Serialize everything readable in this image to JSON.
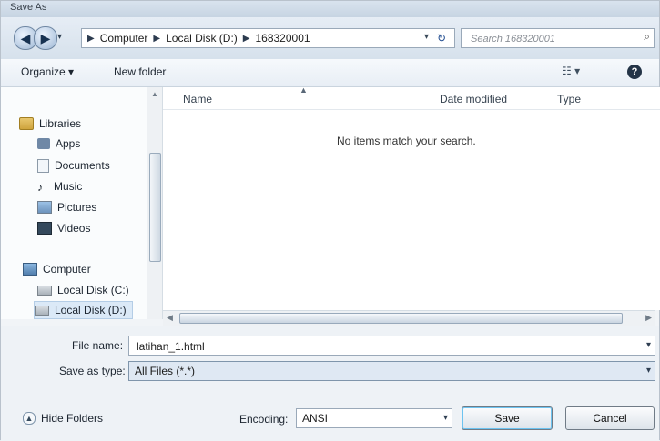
{
  "window": {
    "title": "Save As",
    "title_right": ""
  },
  "address_bar": {
    "crumbs": [
      "Computer",
      "Local Disk (D:)",
      "168320001"
    ],
    "search_placeholder": "Search 168320001"
  },
  "toolbar": {
    "organize_label": "Organize ▾",
    "new_folder_label": "New folder"
  },
  "nav_pane": {
    "items": [
      {
        "label": "Libraries",
        "icon": "libraries-icon"
      },
      {
        "label": "Apps",
        "icon": "apps-icon"
      },
      {
        "label": "Documents",
        "icon": "documents-icon"
      },
      {
        "label": "Music",
        "icon": "music-icon"
      },
      {
        "label": "Pictures",
        "icon": "pictures-icon"
      },
      {
        "label": "Videos",
        "icon": "videos-icon"
      },
      {
        "label": "Computer",
        "icon": "computer-icon"
      },
      {
        "label": "Local Disk (C:)",
        "icon": "disk-icon"
      },
      {
        "label": "Local Disk (D:)",
        "icon": "disk-icon"
      }
    ]
  },
  "file_list": {
    "columns": [
      "Name",
      "Date modified",
      "Type"
    ],
    "empty_message": "No items match your search."
  },
  "form": {
    "file_name_label": "File name:",
    "file_name_value": "latihan_1.html",
    "save_type_label": "Save as type:",
    "save_type_value": "All Files (*.*)",
    "encoding_label": "Encoding:",
    "encoding_value": "ANSI"
  },
  "footer": {
    "hide_folders_label": "Hide Folders",
    "save_label": "Save",
    "cancel_label": "Cancel"
  }
}
